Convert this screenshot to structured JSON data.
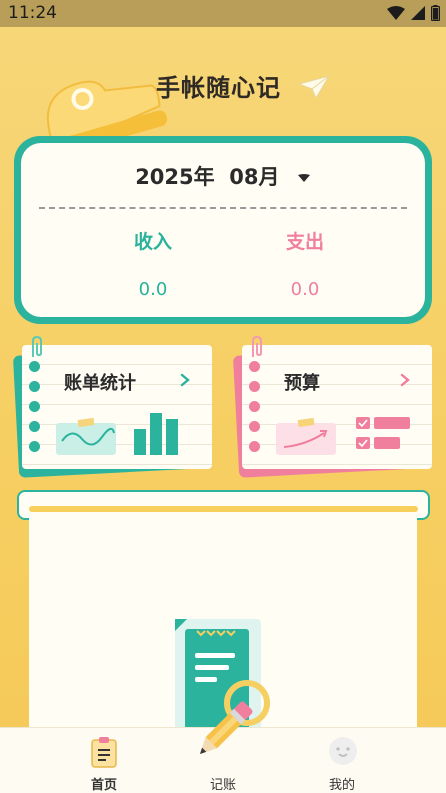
{
  "status_bar": {
    "time": "11:24",
    "icons": [
      "wifi-icon",
      "signal-icon",
      "battery-icon"
    ]
  },
  "header": {
    "title": "手帐随心记"
  },
  "summary": {
    "year_month": "2025年  08月",
    "income_label": "收入",
    "income_value": "0.0",
    "expense_label": "支出",
    "expense_value": "0.0"
  },
  "cards": {
    "stats_title": "账单统计",
    "budget_title": "预算"
  },
  "nav": {
    "home": "首页",
    "record": "记账",
    "mine": "我的"
  },
  "colors": {
    "accent_teal": "#2bb39e",
    "accent_pink": "#f07f9e",
    "background_yellow": "#f6cf62",
    "paper": "#fffdf4"
  }
}
